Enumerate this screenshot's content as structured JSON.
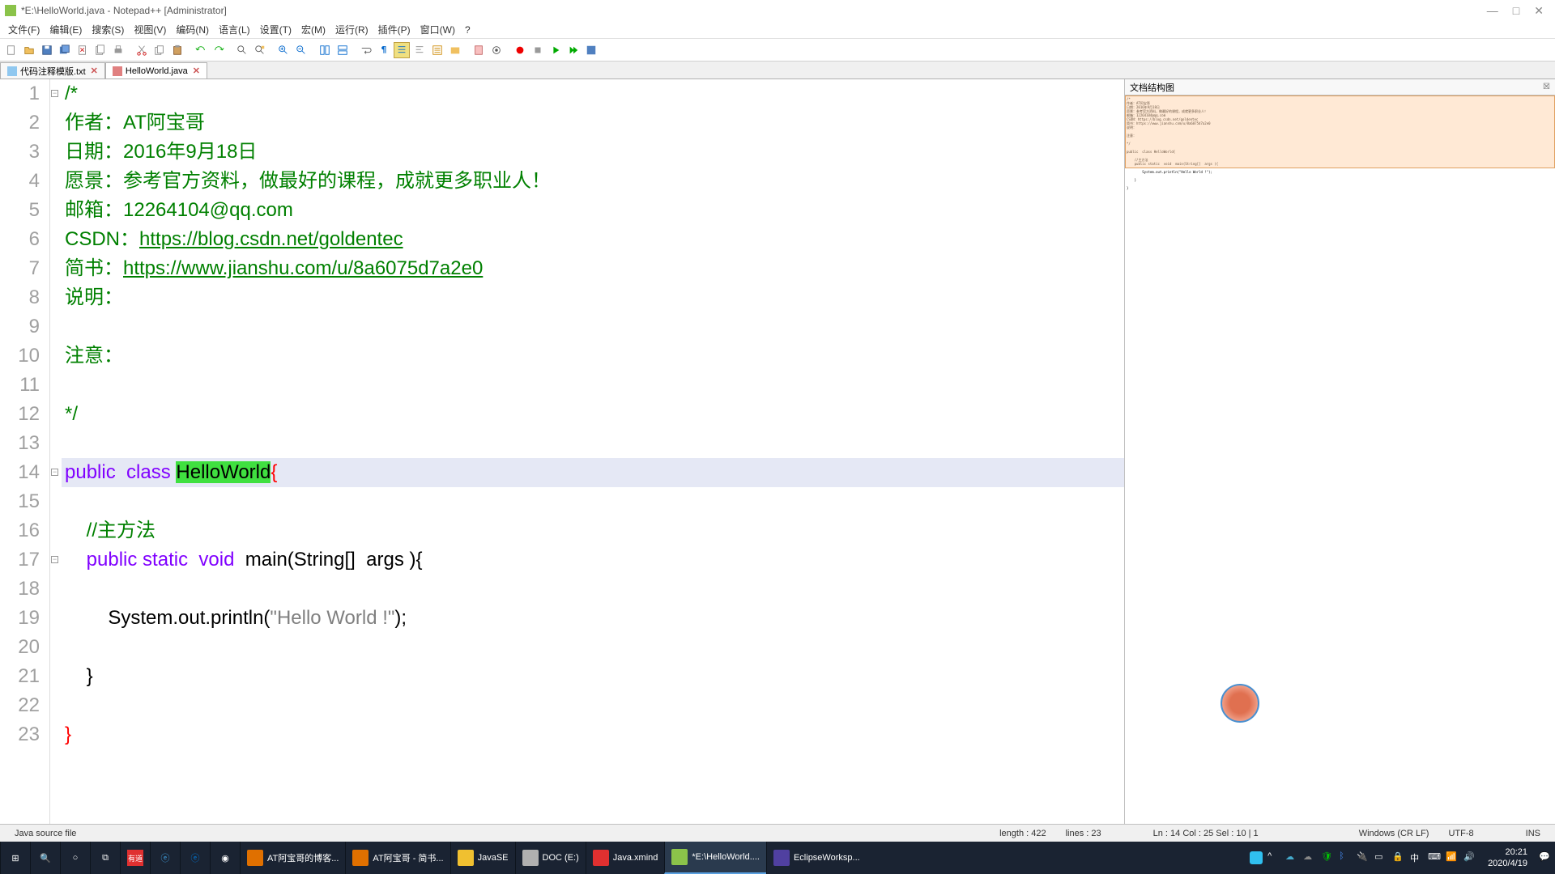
{
  "title": "*E:\\HelloWorld.java - Notepad++ [Administrator]",
  "menu": [
    "文件(F)",
    "编辑(E)",
    "搜索(S)",
    "视图(V)",
    "编码(N)",
    "语言(L)",
    "设置(T)",
    "宏(M)",
    "运行(R)",
    "插件(P)",
    "窗口(W)",
    "?"
  ],
  "tabs": [
    {
      "label": "代码注释模版.txt",
      "active": false
    },
    {
      "label": "HelloWorld.java",
      "active": true
    }
  ],
  "docmap_title": "文档结构图",
  "code": {
    "lines": [
      {
        "n": 1,
        "fold": "-",
        "segs": [
          {
            "t": "/*",
            "c": "c-comment"
          }
        ]
      },
      {
        "n": 2,
        "segs": [
          {
            "t": "作者：AT阿宝哥",
            "c": "c-comment"
          }
        ]
      },
      {
        "n": 3,
        "segs": [
          {
            "t": "日期：2016年9月18日",
            "c": "c-comment"
          }
        ]
      },
      {
        "n": 4,
        "segs": [
          {
            "t": "愿景：参考官方资料，做最好的课程，成就更多职业人！",
            "c": "c-comment"
          }
        ]
      },
      {
        "n": 5,
        "segs": [
          {
            "t": "邮箱：12264104@qq.com",
            "c": "c-comment"
          }
        ]
      },
      {
        "n": 6,
        "segs": [
          {
            "t": "CSDN：",
            "c": "c-comment"
          },
          {
            "t": "https://blog.csdn.net/goldentec",
            "c": "c-link"
          }
        ]
      },
      {
        "n": 7,
        "segs": [
          {
            "t": "简书：",
            "c": "c-comment"
          },
          {
            "t": "https://www.jianshu.com/u/8a6075d7a2e0",
            "c": "c-link"
          }
        ]
      },
      {
        "n": 8,
        "segs": [
          {
            "t": "说明：",
            "c": "c-comment"
          }
        ]
      },
      {
        "n": 9,
        "segs": [
          {
            "t": "",
            "c": "c-comment"
          }
        ]
      },
      {
        "n": 10,
        "segs": [
          {
            "t": "注意：",
            "c": "c-comment"
          }
        ]
      },
      {
        "n": 11,
        "segs": [
          {
            "t": "",
            "c": "c-comment"
          }
        ]
      },
      {
        "n": 12,
        "segs": [
          {
            "t": "*/",
            "c": "c-comment"
          }
        ]
      },
      {
        "n": 13,
        "segs": [
          {
            "t": "",
            "c": "c-normal"
          }
        ]
      },
      {
        "n": 14,
        "fold": "-",
        "hl": true,
        "segs": [
          {
            "t": "public  ",
            "c": "c-kw"
          },
          {
            "t": "class ",
            "c": "c-kw"
          },
          {
            "t": "HelloWorld",
            "c": "c-match"
          },
          {
            "t": "{",
            "c": "c-brace"
          }
        ]
      },
      {
        "n": 15,
        "segs": [
          {
            "t": "",
            "c": "c-normal"
          }
        ]
      },
      {
        "n": 16,
        "segs": [
          {
            "t": "    ",
            "c": "c-normal"
          },
          {
            "t": "//主方法",
            "c": "c-comment"
          }
        ]
      },
      {
        "n": 17,
        "fold": "-",
        "segs": [
          {
            "t": "    ",
            "c": "c-normal"
          },
          {
            "t": "public static  void  ",
            "c": "c-kw"
          },
          {
            "t": "main(String[]  args ){",
            "c": "c-normal"
          }
        ]
      },
      {
        "n": 18,
        "segs": [
          {
            "t": "",
            "c": "c-normal"
          }
        ]
      },
      {
        "n": 19,
        "segs": [
          {
            "t": "        System.out.println(",
            "c": "c-normal"
          },
          {
            "t": "\"Hello World !\"",
            "c": "c-str"
          },
          {
            "t": ");",
            "c": "c-normal"
          }
        ]
      },
      {
        "n": 20,
        "segs": [
          {
            "t": "",
            "c": "c-normal"
          }
        ]
      },
      {
        "n": 21,
        "segs": [
          {
            "t": "    }",
            "c": "c-normal"
          }
        ]
      },
      {
        "n": 22,
        "segs": [
          {
            "t": "",
            "c": "c-normal"
          }
        ]
      },
      {
        "n": 23,
        "segs": [
          {
            "t": "}",
            "c": "c-brace"
          }
        ]
      }
    ]
  },
  "status": {
    "filetype": "Java source file",
    "length": "length : 422",
    "lines": "lines : 23",
    "pos": "Ln : 14    Col : 25    Sel : 10 | 1",
    "eol": "Windows (CR LF)",
    "encoding": "UTF-8",
    "mode": "INS"
  },
  "taskbar": {
    "items": [
      {
        "label": "AT阿宝哥的博客...",
        "color": "#e07000"
      },
      {
        "label": "AT阿宝哥 - 简书...",
        "color": "#e07000"
      },
      {
        "label": "JavaSE",
        "color": "#f0c030"
      },
      {
        "label": "DOC (E:)",
        "color": "#b0b0b0"
      },
      {
        "label": "Java.xmind",
        "color": "#e03030"
      },
      {
        "label": "*E:\\HelloWorld....",
        "color": "#8bc34a",
        "active": true
      },
      {
        "label": "EclipseWorksp...",
        "color": "#5040a0"
      }
    ],
    "time": "20:21",
    "date": "2020/4/19"
  }
}
